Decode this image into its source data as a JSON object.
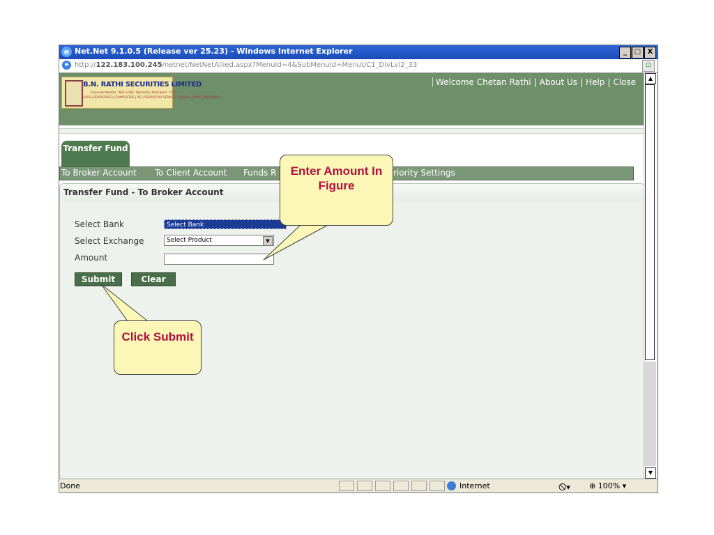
{
  "window": {
    "title": "Net.Net 9.1.0.5 (Release ver 25.23) - Windows Internet Explorer",
    "minimize": "_",
    "maximize": "□",
    "close": "X"
  },
  "address": {
    "prefix": "http://",
    "host": "122.183.100.245",
    "path": "/netnet/NetNetAllied.aspx?MenuId=4&SubMenuId=MenuUC1_DivLvl2_33"
  },
  "logo": {
    "name": "B.N. RATHI SECURITIES LIMITED",
    "line1": "Corporate Member : NSE & BSE. Depository Participant : CDSL",
    "line2": "CASH | DERIVATIVES | COMMODITIES | IPO | DEPOSITORY SERVICES | MUTUAL FUNDS | INSURANCE"
  },
  "header": {
    "welcome": "Welcome Chetan Rathi",
    "about": "About Us",
    "help": "Help",
    "close": "Close",
    "sep": "|"
  },
  "tab": {
    "label": "Transfer Fund"
  },
  "submenu": {
    "to_broker": "To Broker Account",
    "to_client": "To Client Account",
    "funds_r": "Funds R",
    "priority": "riority Settings"
  },
  "section": {
    "title": "Transfer Fund - To Broker Account"
  },
  "form": {
    "bank_label": "Select Bank",
    "bank_value": "Select Bank",
    "exchange_label": "Select Exchange",
    "exchange_value": "Select Product",
    "amount_label": "Amount",
    "amount_value": "",
    "submit": "Submit",
    "clear": "Clear"
  },
  "callouts": {
    "amount": "Enter Amount In Figure",
    "submit": "Click Submit"
  },
  "status": {
    "text": "Done",
    "zone": "Internet",
    "zoom": "100%"
  }
}
